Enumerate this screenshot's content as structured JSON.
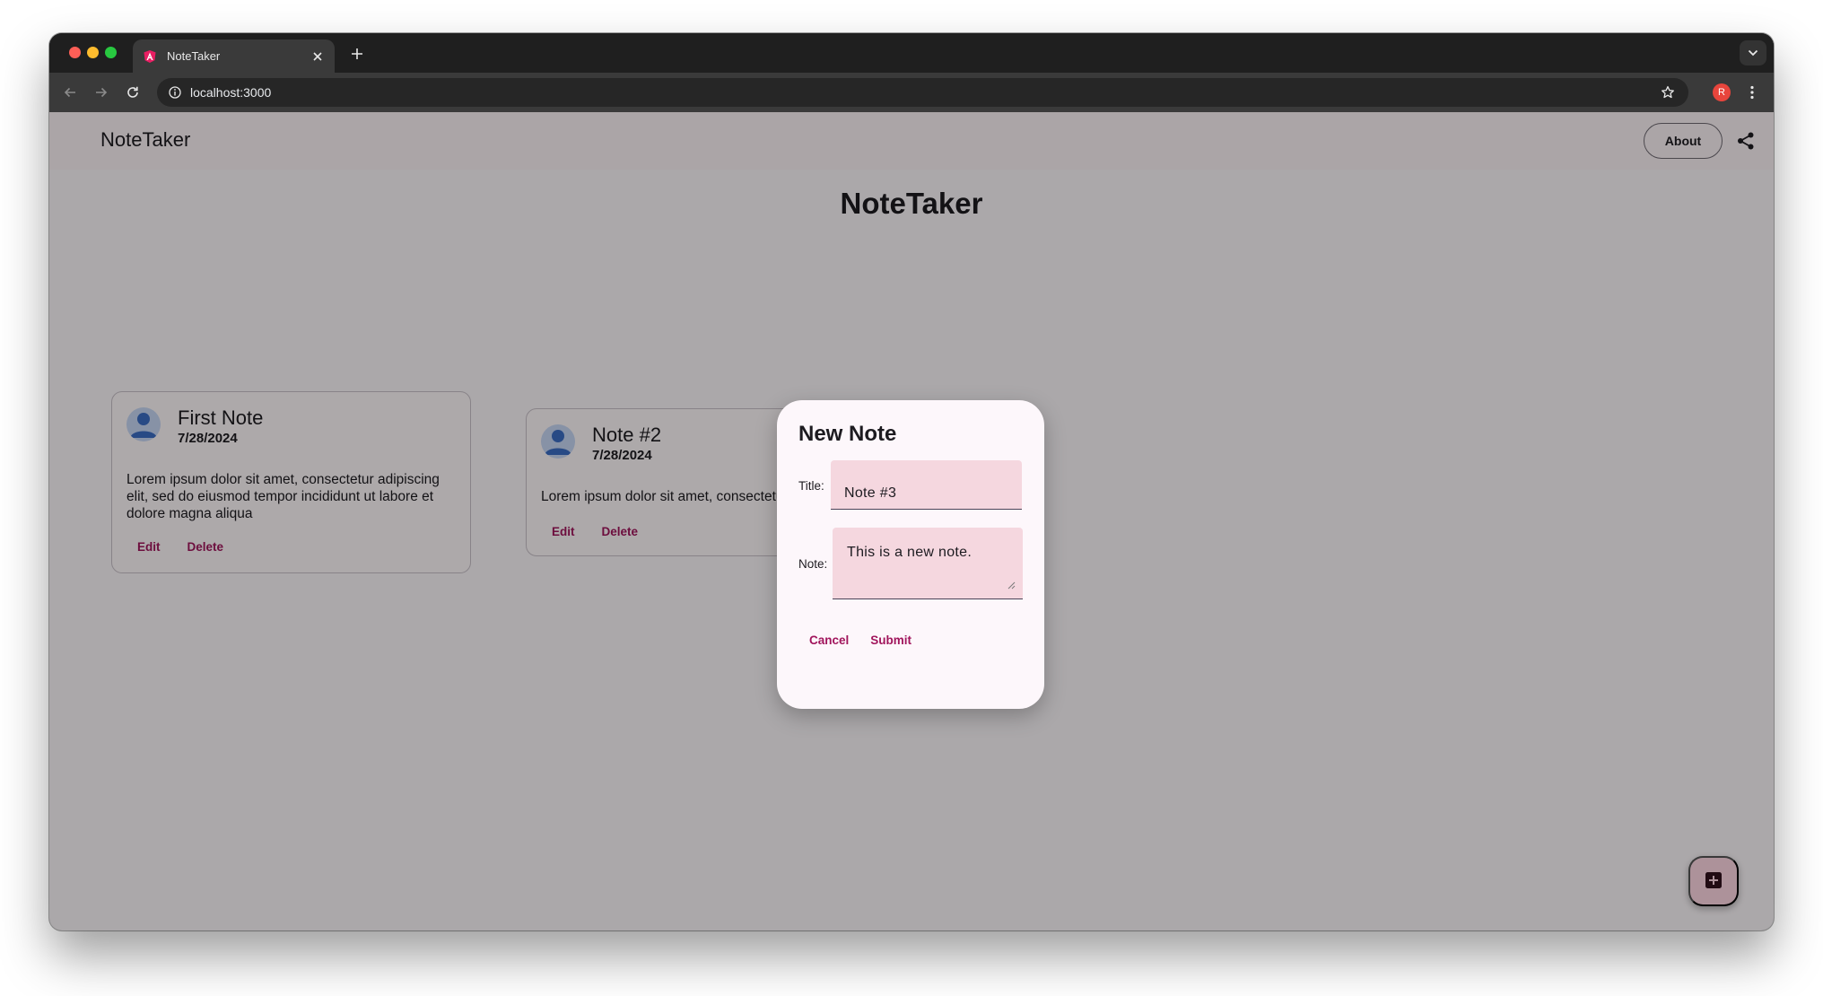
{
  "browser": {
    "tab_title": "NoteTaker",
    "url": "localhost:3000",
    "profile_initial": "R"
  },
  "app": {
    "brand": "NoteTaker",
    "about_label": "About",
    "page_heading": "NoteTaker"
  },
  "notes": [
    {
      "title": "First Note",
      "date": "7/28/2024",
      "body": "Lorem ipsum dolor sit amet, consectetur adipiscing elit, sed do eiusmod tempor incididunt ut labore et dolore magna aliqua",
      "edit_label": "Edit",
      "delete_label": "Delete"
    },
    {
      "title": "Note #2",
      "date": "7/28/2024",
      "body": "Lorem ipsum dolor sit amet, consectetur adipiscing elit, sed do eiusmod tempor",
      "edit_label": "Edit",
      "delete_label": "Delete"
    }
  ],
  "dialog": {
    "title": "New Note",
    "title_label": "Title:",
    "title_value": "Note #3",
    "note_label": "Note:",
    "note_value": "This is a new note.",
    "cancel_label": "Cancel",
    "submit_label": "Submit"
  },
  "colors": {
    "accent": "#a1155c",
    "input_fill": "#f5d7df",
    "dialog_bg": "#fdf7fb",
    "fab_bg": "#ffd8e4"
  },
  "icons": {
    "favicon": "angular-logo-icon",
    "share": "share-icon",
    "fab": "add-box-icon",
    "avatar": "person-avatar-icon"
  }
}
